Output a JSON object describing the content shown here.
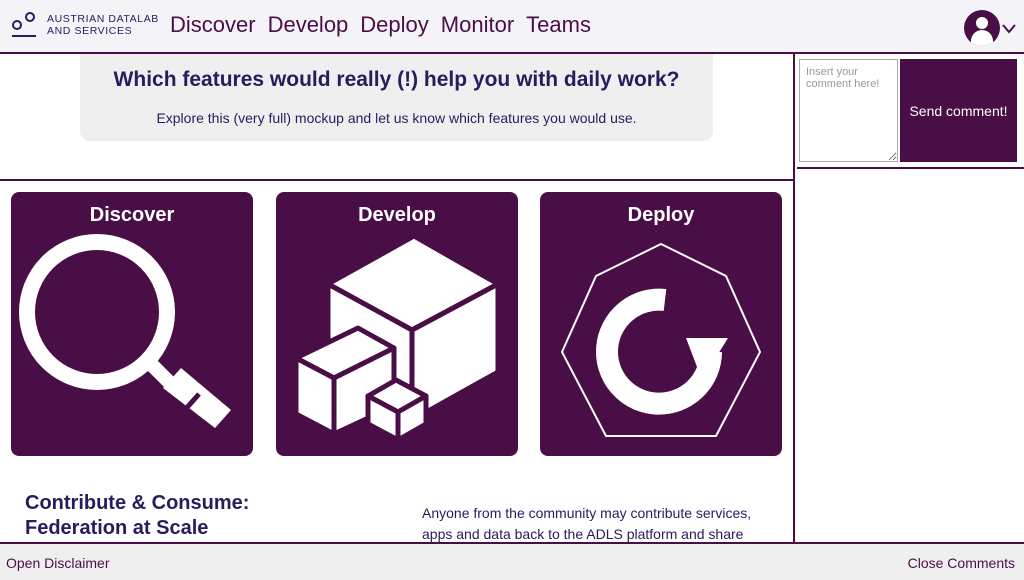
{
  "header": {
    "logo_line1": "AUSTRIAN DATALAB",
    "logo_line2": "AND SERVICES",
    "nav": [
      "Discover",
      "Develop",
      "Deploy",
      "Monitor",
      "Teams"
    ]
  },
  "banner": {
    "title": "Which features would really (!) help you with daily work?",
    "subtitle": "Explore this (very full) mockup and let us know which features you would use."
  },
  "cards": [
    {
      "title": "Discover",
      "icon": "magnifier-icon"
    },
    {
      "title": "Develop",
      "icon": "cubes-icon"
    },
    {
      "title": "Deploy",
      "icon": "deploy-cycle-icon"
    }
  ],
  "contribute": {
    "title": "Contribute & Consume: Federation at Scale",
    "text": "Anyone from the community may contribute services, apps and data back to the ADLS platform and share"
  },
  "comments": {
    "placeholder": "Insert your comment here!",
    "value": "",
    "send_label": "Send comment!"
  },
  "footer": {
    "disclaimer_label": "Open Disclaimer",
    "close_label": "Close Comments"
  },
  "colors": {
    "accent": "#4a0e46",
    "text": "#2a1a5e",
    "header_bg": "#f4f3f8",
    "banner_bg": "#efeff0"
  }
}
